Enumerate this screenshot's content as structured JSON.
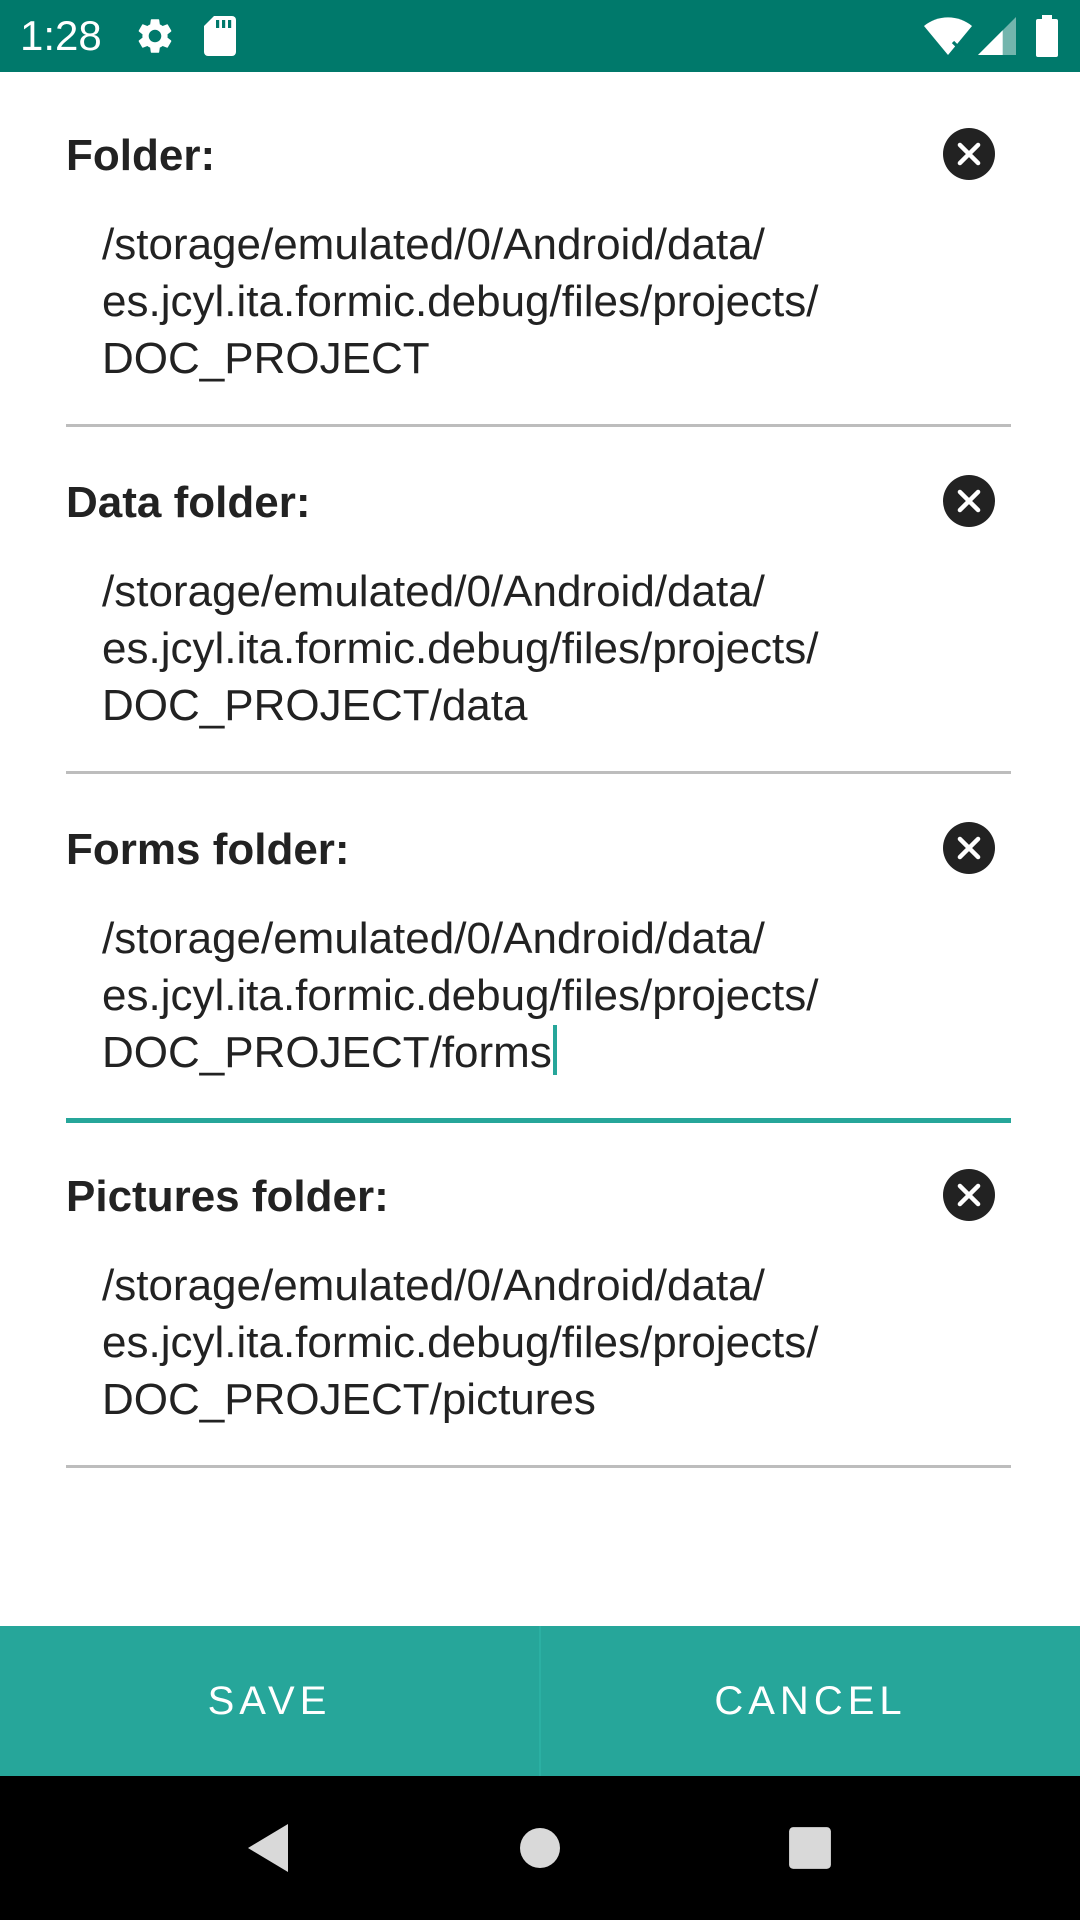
{
  "status_bar": {
    "time": "1:28",
    "icons": [
      "settings-icon",
      "sd-card-icon",
      "wifi-icon",
      "signal-icon",
      "battery-icon"
    ]
  },
  "fields": [
    {
      "label": "Folder:",
      "value": "/storage/emulated/0/Android/data/\nes.jcyl.ita.formic.debug/files/projects/\nDOC_PROJECT",
      "focused": false
    },
    {
      "label": "Data folder:",
      "value": "/storage/emulated/0/Android/data/\nes.jcyl.ita.formic.debug/files/projects/\nDOC_PROJECT/data",
      "focused": false
    },
    {
      "label": "Forms folder:",
      "value": "/storage/emulated/0/Android/data/\nes.jcyl.ita.formic.debug/files/projects/\nDOC_PROJECT/forms",
      "focused": true
    },
    {
      "label": "Pictures folder:",
      "value": "/storage/emulated/0/Android/data/\nes.jcyl.ita.formic.debug/files/projects/\nDOC_PROJECT/pictures",
      "focused": false
    }
  ],
  "buttons": {
    "save_label": "SAVE",
    "cancel_label": "CANCEL"
  },
  "nav_bar": {
    "icons": [
      "back-icon",
      "home-icon",
      "recents-icon"
    ]
  },
  "colors": {
    "status_bar": "#00796B",
    "accent": "#26A69A",
    "navigation": "#000000"
  }
}
